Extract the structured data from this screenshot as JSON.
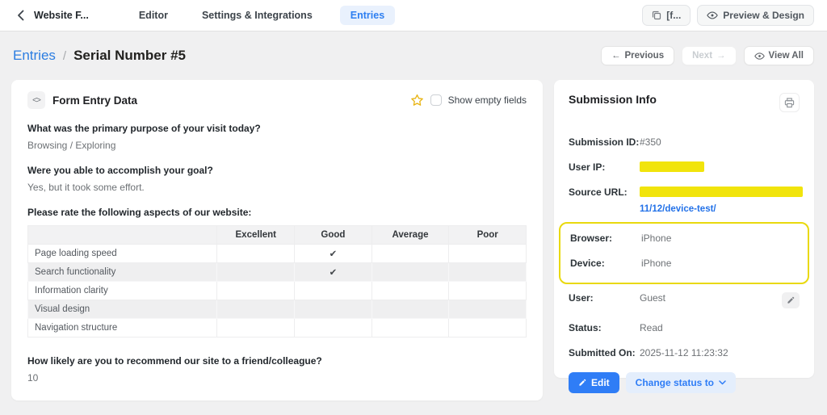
{
  "topbar": {
    "form_title": "Website F...",
    "tabs": [
      {
        "label": "Editor"
      },
      {
        "label": "Settings & Integrations"
      },
      {
        "label": "Entries"
      }
    ],
    "shortcode_label": "[f...",
    "preview_label": "Preview & Design"
  },
  "breadcrumb": {
    "parent": "Entries",
    "separator": "/",
    "current": "Serial Number #5"
  },
  "nav_actions": {
    "previous": "Previous",
    "next": "Next",
    "view_all": "View All"
  },
  "icons": {
    "arrow_left": "←",
    "arrow_right": "→",
    "code": "<>"
  },
  "entry_card": {
    "title": "Form Entry Data",
    "show_empty_label": "Show empty fields",
    "questions": [
      {
        "q": "What was the primary purpose of your visit today?",
        "a": "Browsing / Exploring"
      },
      {
        "q": "Were you able to accomplish your goal?",
        "a": "Yes, but it took some effort."
      }
    ],
    "matrix": {
      "label": "Please rate the following aspects of our website:",
      "columns": [
        "Excellent",
        "Good",
        "Average",
        "Poor"
      ],
      "rows": [
        {
          "label": "Page loading speed",
          "cells": [
            "",
            "✔",
            "",
            ""
          ]
        },
        {
          "label": "Search functionality",
          "cells": [
            "",
            "✔",
            "",
            ""
          ]
        },
        {
          "label": "Information clarity",
          "cells": [
            "",
            "",
            "",
            ""
          ]
        },
        {
          "label": "Visual design",
          "cells": [
            "",
            "",
            "",
            ""
          ]
        },
        {
          "label": "Navigation structure",
          "cells": [
            "",
            "",
            "",
            ""
          ]
        }
      ]
    },
    "nps": {
      "q": "How likely are you to recommend our site to a friend/colleague?",
      "a": "10"
    }
  },
  "submission_card": {
    "title": "Submission Info",
    "submission_id_label": "Submission ID:",
    "submission_id": "#350",
    "user_ip_label": "User IP:",
    "source_url_label": "Source URL:",
    "source_url_link": "11/12/device-test/",
    "browser_label": "Browser:",
    "browser": "iPhone",
    "device_label": "Device:",
    "device": "iPhone",
    "user_label": "User:",
    "user": "Guest",
    "status_label": "Status:",
    "status": "Read",
    "submitted_label": "Submitted On:",
    "submitted": "2025-11-12 11:23:32",
    "edit_label": "Edit",
    "change_status_label": "Change status to"
  },
  "colors": {
    "accent_blue": "#2f7df6",
    "link_blue": "#2271e8",
    "highlight_yellow": "#f1e40c",
    "annotation_yellow": "#e9d90e"
  }
}
